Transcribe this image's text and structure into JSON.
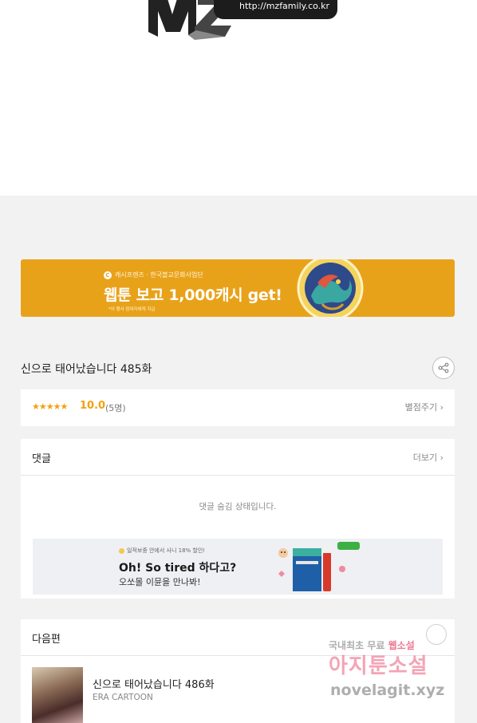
{
  "top_banner": {
    "url_text": "http://mzfamily.co.kr"
  },
  "promo": {
    "sponsor_mark": "C",
    "sponsor_text": "캐시프렌즈 · 한국블교문화사업단",
    "headline": "웹툰 보고 1,000캐시 get!",
    "fine_print": "*이 행사 참여자에게 지급"
  },
  "episode": {
    "title": "신으로 태어났습니다 485화"
  },
  "rating": {
    "stars": "★★★★★",
    "score": "10.0",
    "count": "(5명)",
    "rate_link": "별점주기 ›"
  },
  "comments": {
    "title": "댓글",
    "more_link": "더보기 ›",
    "hidden_message": "댓글 숨김 상태입니다."
  },
  "ad": {
    "small_text": "일적보중 안에서 사니 18% 할인!",
    "headline": "Oh! So tired 하다고?",
    "sub": "오쏘몰 이뮨을 만나봐!"
  },
  "next": {
    "section_title": "다음편",
    "title": "신으로 태어났습니다 486화",
    "author": "ERA CARTOON"
  },
  "watermark": {
    "line1_prefix": "국내최초 무료 ",
    "line1_highlight": "웹소설",
    "line2": "아지툰소설",
    "line3": "novelagit.xyz"
  },
  "colors": {
    "promo_bg": "#e8a21a",
    "star": "#f2a10f",
    "page_bg": "#f2f2f2"
  }
}
